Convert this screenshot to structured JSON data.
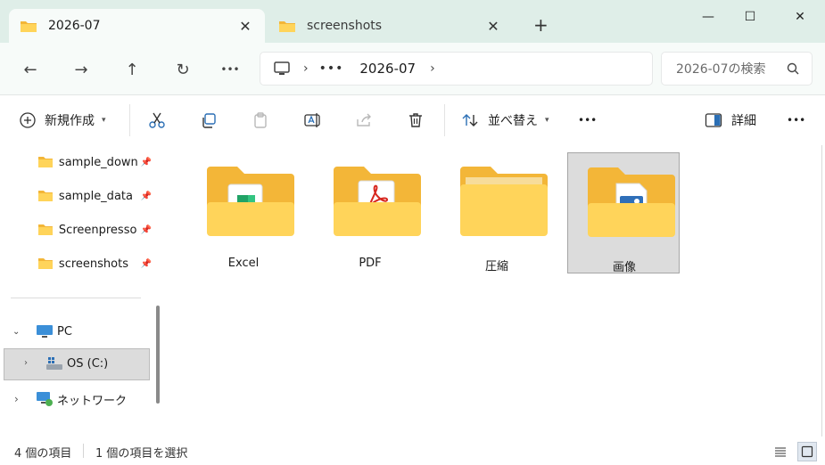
{
  "tabs": [
    {
      "label": "2026-07",
      "active": true
    },
    {
      "label": "screenshots",
      "active": false
    }
  ],
  "window": {
    "new_tab": "+",
    "minimize": "—",
    "maximize": "☐",
    "close": "✕"
  },
  "nav": {
    "back": "←",
    "forward": "→",
    "up": "↑",
    "refresh": "↻",
    "more": "•••"
  },
  "address": {
    "separator": "›",
    "overflow": "•••",
    "crumb": "2026-07",
    "trail": "›"
  },
  "search": {
    "placeholder": "2026-07の検索"
  },
  "toolbar": {
    "new_label": "新規作成",
    "sort_label": "並べ替え",
    "more": "•••",
    "details_label": "詳細",
    "details_more": "•••"
  },
  "sidebar": {
    "quick_access": [
      {
        "label": "sample_downl"
      },
      {
        "label": "sample_data"
      },
      {
        "label": "Screenpresso"
      },
      {
        "label": "screenshots"
      }
    ],
    "pc_label": "PC",
    "drive_label": "OS (C:)",
    "network_label": "ネットワーク"
  },
  "folders": [
    {
      "label": "Excel",
      "selected": false,
      "badge": "excel"
    },
    {
      "label": "PDF",
      "selected": false,
      "badge": "pdf"
    },
    {
      "label": "圧縮",
      "selected": false,
      "badge": "none"
    },
    {
      "label": "画像",
      "selected": true,
      "badge": "image"
    }
  ],
  "status": {
    "count": "4 個の項目",
    "selection": "1 個の項目を選択"
  },
  "colors": {
    "titlebar": "#dfeee8",
    "folder_back": "#f3b638",
    "folder_front": "#ffd45a",
    "accent": "#0f6cbd"
  }
}
